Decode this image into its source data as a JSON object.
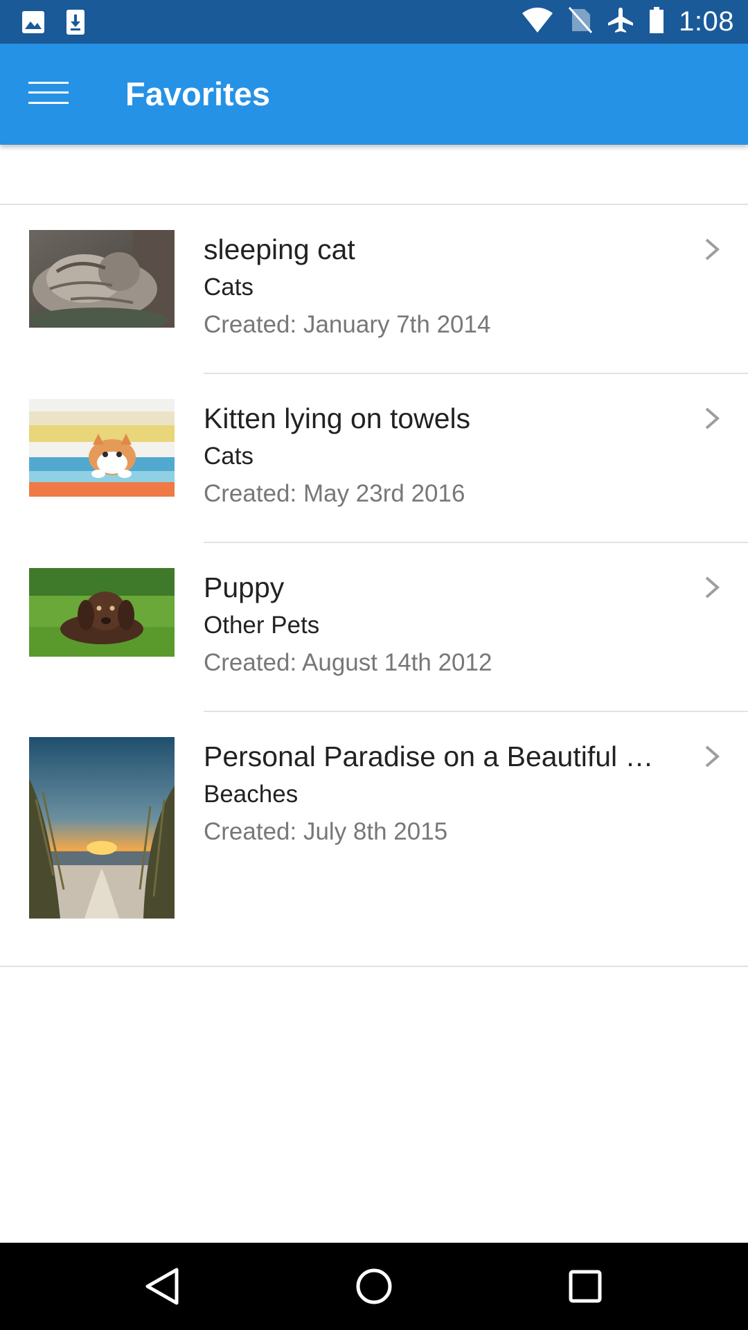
{
  "status_bar": {
    "time": "1:08",
    "icons_left": [
      "image-icon",
      "download-icon"
    ],
    "icons_right": [
      "wifi-icon",
      "no-sim-icon",
      "airplane-icon",
      "battery-icon"
    ]
  },
  "app_bar": {
    "title": "Favorites",
    "menu_icon": "hamburger-menu-icon",
    "color": "#2692e6"
  },
  "favorites": [
    {
      "title": "sleeping cat",
      "category": "Cats",
      "created": "Created: January 7th 2014",
      "thumbnail": "sleeping-cat-image"
    },
    {
      "title": "Kitten lying on towels",
      "category": "Cats",
      "created": "Created: May 23rd 2016",
      "thumbnail": "kitten-towels-image"
    },
    {
      "title": "Puppy",
      "category": "Other Pets",
      "created": "Created: August 14th 2012",
      "thumbnail": "puppy-image"
    },
    {
      "title": "Personal Paradise on a Beautiful …",
      "category": "Beaches",
      "created": "Created: July 8th 2015",
      "thumbnail": "beach-sunset-image"
    }
  ],
  "nav_bar": {
    "buttons": [
      "back-icon",
      "home-icon",
      "recents-icon"
    ]
  }
}
